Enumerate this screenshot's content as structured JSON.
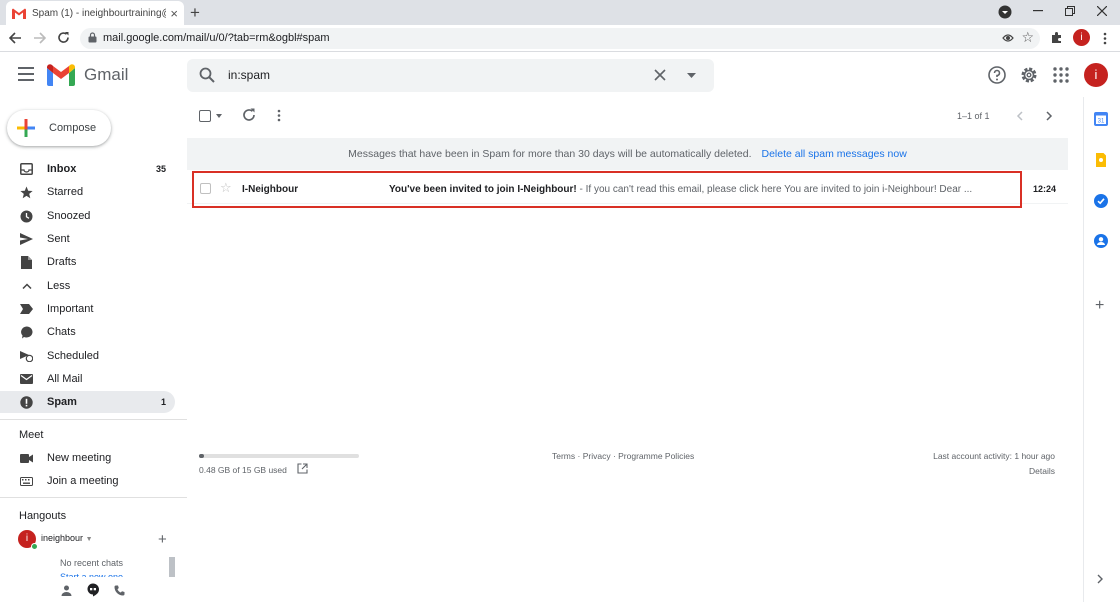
{
  "browser": {
    "tab_title": "Spam (1) - ineighbourtraining@g",
    "tab_close": "×",
    "new_tab": "+",
    "url": "mail.google.com/mail/u/0/?tab=rm&ogbl#spam",
    "profile_initial": "i"
  },
  "header": {
    "app_name": "Gmail",
    "search_value": "in:spam",
    "avatar_initial": "i"
  },
  "sidebar": {
    "compose_label": "Compose",
    "items": [
      {
        "label": "Inbox",
        "count": "35",
        "icon": "inbox-icon"
      },
      {
        "label": "Starred",
        "count": "",
        "icon": "star-icon"
      },
      {
        "label": "Snoozed",
        "count": "",
        "icon": "clock-icon"
      },
      {
        "label": "Sent",
        "count": "",
        "icon": "send-icon"
      },
      {
        "label": "Drafts",
        "count": "",
        "icon": "draft-icon"
      },
      {
        "label": "Less",
        "count": "",
        "icon": "chevron-up-icon"
      },
      {
        "label": "Important",
        "count": "",
        "icon": "important-icon"
      },
      {
        "label": "Chats",
        "count": "",
        "icon": "chat-icon"
      },
      {
        "label": "Scheduled",
        "count": "",
        "icon": "scheduled-icon"
      },
      {
        "label": "All Mail",
        "count": "",
        "icon": "mail-icon"
      },
      {
        "label": "Spam",
        "count": "1",
        "icon": "spam-icon"
      }
    ],
    "meet_title": "Meet",
    "meet_items": [
      {
        "label": "New meeting",
        "icon": "video-icon"
      },
      {
        "label": "Join a meeting",
        "icon": "keyboard-icon"
      }
    ],
    "hangouts_title": "Hangouts",
    "hangouts_user": "ineighbour",
    "hangouts_user_initial": "i",
    "no_recent_chats": "No recent chats",
    "start_new_one": "Start a new one"
  },
  "toolbar": {
    "pager_text": "1–1 of 1"
  },
  "notice": {
    "text": "Messages that have been in Spam for more than 30 days will be automatically deleted.",
    "link": "Delete all spam messages now"
  },
  "emails": [
    {
      "sender": "I-Neighbour",
      "subject": "You've been invited to join I-Neighbour!",
      "snippet": " - If you can't read this email, please click here You are invited to join i-Neighbour! Dear ...",
      "time": "12:24"
    }
  ],
  "footer": {
    "storage_text": "0.48 GB of 15 GB used",
    "storage_used_fraction": 0.032,
    "terms": "Terms",
    "privacy": "Privacy",
    "policies": "Programme Policies",
    "separator": " · ",
    "last_activity": "Last account activity: 1 hour ago",
    "details": "Details"
  },
  "colors": {
    "gmail_red": "#ea4335",
    "highlight_red": "#d93025",
    "link_blue": "#1a73e8"
  }
}
